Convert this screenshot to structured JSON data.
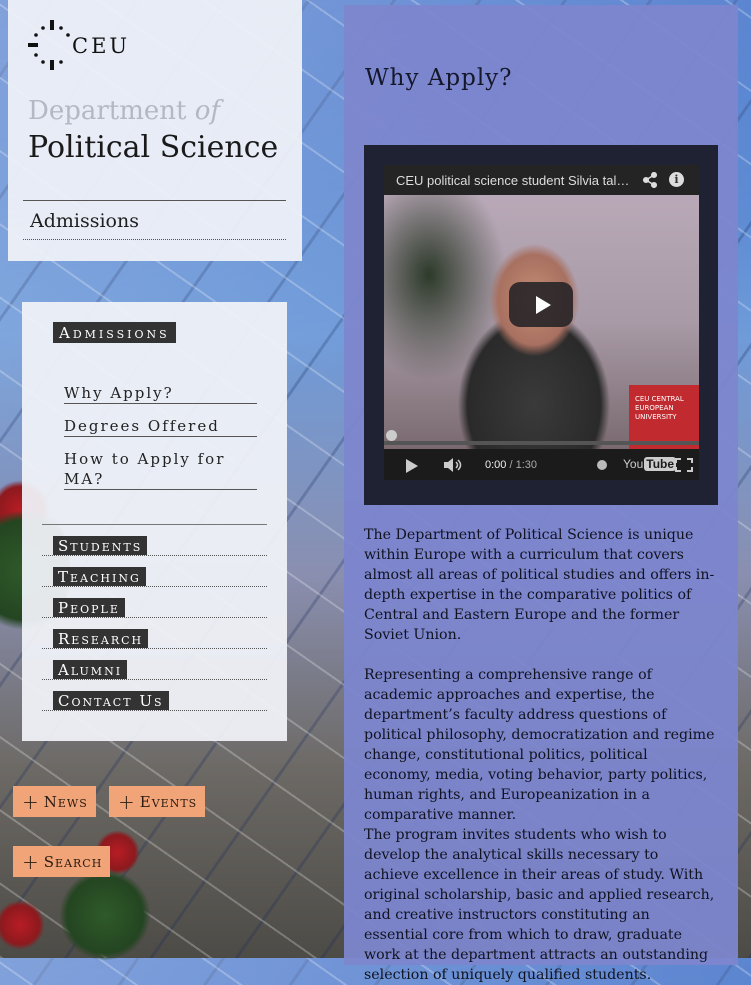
{
  "header": {
    "logo_text": "CEU",
    "dept_prefix": "Department",
    "dept_of": "of",
    "dept_name": "Political Science",
    "section": "Admissions"
  },
  "sidebar": {
    "heading": "Admissions",
    "subnav": [
      "Why Apply?",
      "Degrees Offered",
      "How to Apply for MA?"
    ],
    "nav": [
      "Students",
      "Teaching",
      "People",
      "Research",
      "Alumni",
      "Contact Us"
    ]
  },
  "buttons": {
    "news": "News",
    "events": "Events",
    "search": "Search"
  },
  "main": {
    "title": "Why Apply?",
    "video": {
      "title": "CEU political science student Silvia tal…",
      "time_current": "0:00",
      "time_sep": " / ",
      "time_total": "1:30",
      "youtube_label": "You",
      "youtube_tube": "Tube",
      "watermark": "CEU CENTRAL EUROPEAN UNIVERSITY"
    },
    "paragraphs": [
      "The Department of Political Science is unique within Europe with a curriculum that covers almost all areas of political studies and offers in-depth expertise in the comparative politics of Central and Eastern Europe and the former Soviet Union.",
      "Representing a comprehensive range of academic approaches and expertise, the department’s faculty address questions of political philosophy, democratization and regime change, constitutional politics, political economy, media, voting behavior, party politics, human rights, and Europeanization in a comparative manner.",
      "The program invites students who wish to develop the analytical skills necessary to achieve excellence in their areas of study. With original scholarship, basic and applied research, and creative instructors constituting an essential core from which to draw, graduate work at the department attracts an outstanding selection of uniquely qualified students."
    ]
  },
  "colors": {
    "content_bg": "#7c86cd",
    "button_orange": "#f0a478",
    "nav_label_bg": "#333333"
  }
}
